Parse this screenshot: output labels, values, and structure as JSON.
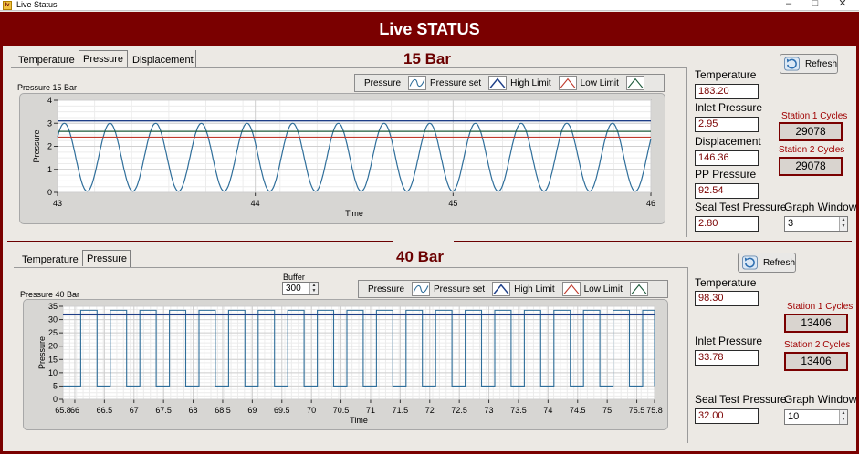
{
  "window": {
    "title": "Live Status"
  },
  "banner": {
    "title": "Live STATUS"
  },
  "colors": {
    "brand": "#7a0000",
    "value_text": "#7a0000",
    "series": "#2f6e9a",
    "high_limit": "#1f3f88",
    "low_limit": "#c0392b",
    "limit_green": "#1c5a3a"
  },
  "top": {
    "title": "15 Bar",
    "tabs": [
      "Temperature",
      "Pressure",
      "Displacement"
    ],
    "active_tab": "Pressure",
    "chart_label": "Pressure 15 Bar",
    "legend": {
      "pressure": "Pressure",
      "pressure_set": "Pressure set",
      "high_limit": "High Limit",
      "low_limit": "Low Limit"
    },
    "refresh_label": "Refresh",
    "fields": [
      {
        "label": "Temperature",
        "value": "183.20"
      },
      {
        "label": "Inlet Pressure",
        "value": "2.95"
      },
      {
        "label": "Displacement",
        "value": "146.36"
      },
      {
        "label": "PP Pressure",
        "value": "92.54"
      },
      {
        "label": "Seal Test Pressure",
        "value": "2.80"
      }
    ],
    "cycles": [
      {
        "label": "Station 1 Cycles",
        "value": "29078"
      },
      {
        "label": "Station 2 Cycles",
        "value": "29078"
      }
    ],
    "graph_window": {
      "label": "Graph Window",
      "value": "3"
    }
  },
  "bottom": {
    "title": "40 Bar",
    "tabs": [
      "Temperature",
      "Pressure"
    ],
    "active_tab": "Pressure",
    "chart_label": "Pressure 40 Bar",
    "buffer": {
      "label": "Buffer",
      "value": "300"
    },
    "legend": {
      "pressure": "Pressure",
      "pressure_set": "Pressure set",
      "high_limit": "High Limit",
      "low_limit": "Low Limit"
    },
    "refresh_label": "Refresh",
    "fields": [
      {
        "label": "Temperature",
        "value": "98.30"
      },
      {
        "label": "Inlet Pressure",
        "value": "33.78"
      },
      {
        "label": "Seal Test Pressure",
        "value": "32.00"
      }
    ],
    "cycles": [
      {
        "label": "Station 1 Cycles",
        "value": "13406"
      },
      {
        "label": "Station 2 Cycles",
        "value": "13406"
      }
    ],
    "graph_window": {
      "label": "Graph Window",
      "value": "10"
    }
  },
  "chart_data": [
    {
      "type": "line",
      "xlabel": "Time",
      "ylabel": "Pressure",
      "xlim": [
        43,
        46
      ],
      "ylim": [
        0,
        4
      ],
      "xticks": [
        "43",
        "44",
        "45",
        "46"
      ],
      "yticks": [
        "0",
        "1",
        "2",
        "3",
        "4"
      ],
      "grid": true,
      "series": [
        {
          "name": "Pressure",
          "waveform": "sine",
          "min": 0.05,
          "max": 3.0,
          "cycles_per_unit": 4.33,
          "phase_start_value": 2.4
        },
        {
          "name": "High Limit",
          "constant": 3.1
        },
        {
          "name": "Low Limit",
          "constant": 2.4
        },
        {
          "name": "Pressure set",
          "constant": 2.65
        }
      ]
    },
    {
      "type": "line",
      "xlabel": "Time",
      "ylabel": "Pressure",
      "xlim": [
        65.8,
        75.8
      ],
      "ylim": [
        0,
        35
      ],
      "xticks": [
        "65.8",
        "66",
        "66.5",
        "67",
        "67.5",
        "68",
        "68.5",
        "69",
        "69.5",
        "70",
        "70.5",
        "71",
        "71.5",
        "72",
        "72.5",
        "73",
        "73.5",
        "74",
        "74.5",
        "75",
        "75.5",
        "75.8"
      ],
      "yticks": [
        "0",
        "5",
        "10",
        "15",
        "20",
        "25",
        "30",
        "35"
      ],
      "grid": true,
      "series": [
        {
          "name": "Pressure",
          "waveform": "square",
          "low": 5,
          "high": 33.5,
          "period": 0.5,
          "first_rise": 66.1,
          "duty": 0.55
        },
        {
          "name": "High Limit",
          "constant": 32.0
        }
      ]
    }
  ]
}
